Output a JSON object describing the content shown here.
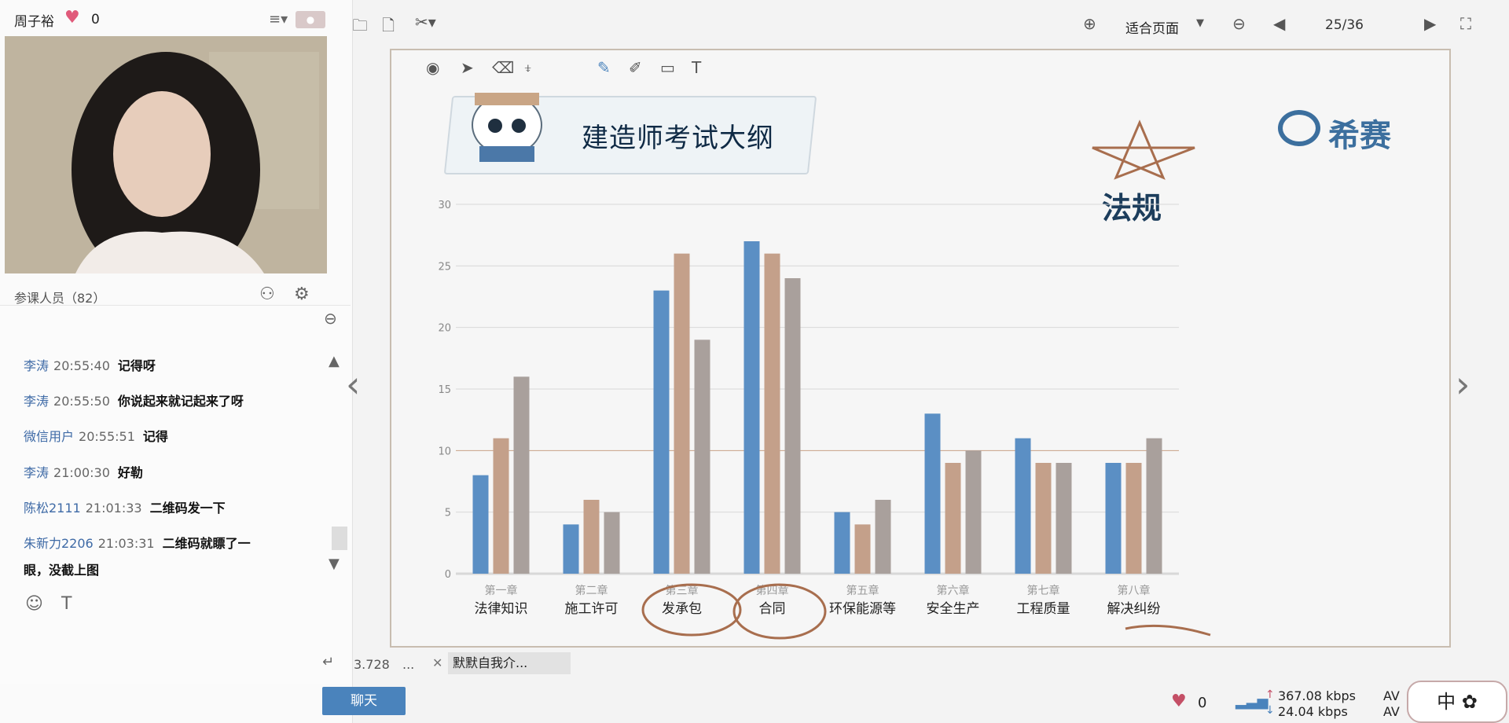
{
  "left": {
    "teacher_name": "周子裕",
    "likes": "0",
    "members_label": "参课人员（82）",
    "messages": [
      {
        "name": "李涛",
        "time": "20:55:40",
        "text": "记得呀"
      },
      {
        "name": "李涛",
        "time": "20:55:50",
        "text": "你说起来就记起来了呀"
      },
      {
        "name": "微信用户",
        "time": "20:55:51",
        "text": "记得"
      },
      {
        "name": "李涛",
        "time": "21:00:30",
        "text": "好勒"
      },
      {
        "name": "陈松2111",
        "time": "21:01:33",
        "text": "二维码发一下"
      },
      {
        "name": "朱新力2206",
        "time": "21:03:31",
        "text": "二维码就瞟了一"
      },
      {
        "name": "",
        "time": "",
        "text": "眼，没截上图"
      }
    ],
    "chat_button": "聊天"
  },
  "toolbar": {
    "fit_page": "适合页面",
    "page_counter": "25/36"
  },
  "slide": {
    "title": "建造师考试大纲",
    "brand": "希赛",
    "law_label": "法规"
  },
  "bottom": {
    "stat_num": "3.728",
    "ellipsis": "...",
    "greeting": "默默自我介...",
    "likes": "0",
    "upload": "367.08 kbps",
    "download": "24.04 kbps",
    "av1": "AV",
    "av2": "AV",
    "ime": "中"
  },
  "colors": {
    "series1": "#5b8fc4",
    "series2": "#c4a08a",
    "series3": "#a9a09c",
    "ink": "#a86e4e",
    "accent": "#4a83bc"
  },
  "chart_data": {
    "type": "bar",
    "categories": [
      {
        "chapter": "第一章",
        "name": "法律知识"
      },
      {
        "chapter": "第二章",
        "name": "施工许可"
      },
      {
        "chapter": "第三章",
        "name": "发承包"
      },
      {
        "chapter": "第四章",
        "name": "合同"
      },
      {
        "chapter": "第五章",
        "name": "环保能源等"
      },
      {
        "chapter": "第六章",
        "name": "安全生产"
      },
      {
        "chapter": "第七章",
        "name": "工程质量"
      },
      {
        "chapter": "第八章",
        "name": "解决纠纷"
      }
    ],
    "series": [
      {
        "values": [
          8,
          4,
          23,
          27,
          5,
          13,
          11,
          9
        ]
      },
      {
        "values": [
          11,
          6,
          26,
          26,
          4,
          9,
          9,
          9
        ]
      },
      {
        "values": [
          16,
          5,
          19,
          24,
          6,
          10,
          9,
          11
        ]
      }
    ],
    "yticks": [
      0,
      5,
      10,
      15,
      20,
      25,
      30
    ],
    "ylim": [
      0,
      30
    ],
    "grid": true
  }
}
